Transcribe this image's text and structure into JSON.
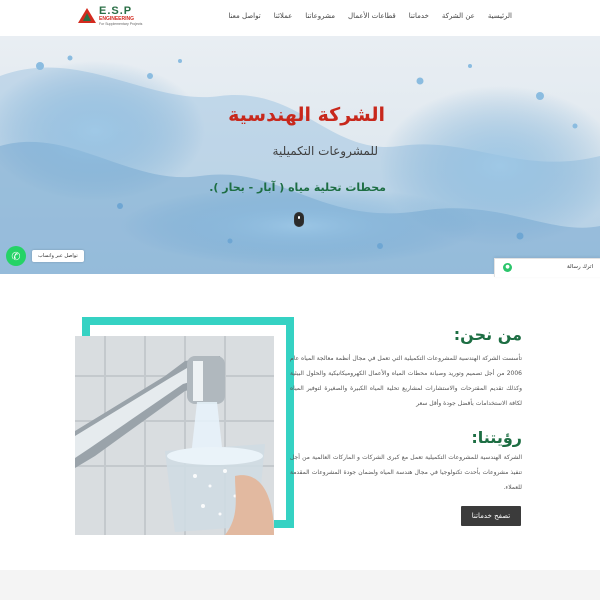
{
  "logo": {
    "title": "E.S.P",
    "subtitle": "ENGINEERING",
    "tagline": "For Supplementary Projects"
  },
  "nav": {
    "items": [
      {
        "label": "الرئيسية"
      },
      {
        "label": "عن الشركة"
      },
      {
        "label": "خدماتنا"
      },
      {
        "label": "قطاعات الأعمال"
      },
      {
        "label": "مشروعاتنا"
      },
      {
        "label": "عملائنا"
      },
      {
        "label": "تواصل معنا"
      }
    ]
  },
  "hero": {
    "title": "الشركة الهندسية",
    "subtitle": "للمشروعات التكميلية",
    "description": "محطات تحلية مياه ( آبار - بحار ).",
    "scroll_icon": "mouse-scroll-icon"
  },
  "whatsapp": {
    "label": "تواصل عبر واتساب",
    "icon": "whatsapp-icon"
  },
  "chat": {
    "label": "اترك رسالة",
    "icon": "chat-icon"
  },
  "about": {
    "title": "من نحن:",
    "text": "تأسست الشركة الهندسية للمشروعات التكميلية التي تعمل في مجال أنظمة معالجة المياه عام 2006 من أجل تصميم وتوريد وصيانة محطات المياه والأعمال الكهروميكانيكية والحلول البيئية وكذلك تقديم المقترحات والاستشارات لمشاريع تحلية المياه الكبيرة والصغيرة لتوفير المياه لكافة الاستخدامات بأفضل جودة وأقل سعر"
  },
  "vision": {
    "title": "رؤيتنا:",
    "text": "الشركة الهندسية للمشروعات التكميلية تعمل مع كبرى الشركات و الماركات العالمية من أجل تنفيذ مشروعات بأحدث تكنولوجيا في مجال هندسة المياه ولضمان جودة المشروعات المقدمة للعملاء.",
    "cta_label": "تصفح خدماتنا"
  },
  "colors": {
    "brand_red": "#c8281c",
    "brand_green": "#1d6e43",
    "frame_teal": "#35d2c3",
    "button_dark": "#3b3b3b",
    "whatsapp_green": "#25d366"
  }
}
